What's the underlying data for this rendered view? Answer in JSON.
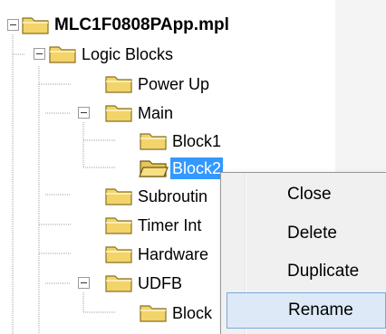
{
  "tree": {
    "root_label": "MLC1F0808PApp.mpl",
    "logic_blocks_label": "Logic Blocks",
    "power_up_label": "Power Up",
    "main_label": "Main",
    "block1_label": "Block1",
    "block2_label": "Block2",
    "subroutines_label": "Subroutin",
    "timer_label": "Timer Int",
    "hardware_label": "Hardware",
    "udfb_label": "UDFB",
    "udfb_block_label": "Block"
  },
  "context_menu": {
    "items": [
      "Close",
      "Delete",
      "Duplicate",
      "Rename"
    ],
    "highlighted": "Rename"
  },
  "colors": {
    "selection": "#3399ff",
    "folder": "#f2d46b",
    "menu_highlight": "#dde9f7"
  }
}
